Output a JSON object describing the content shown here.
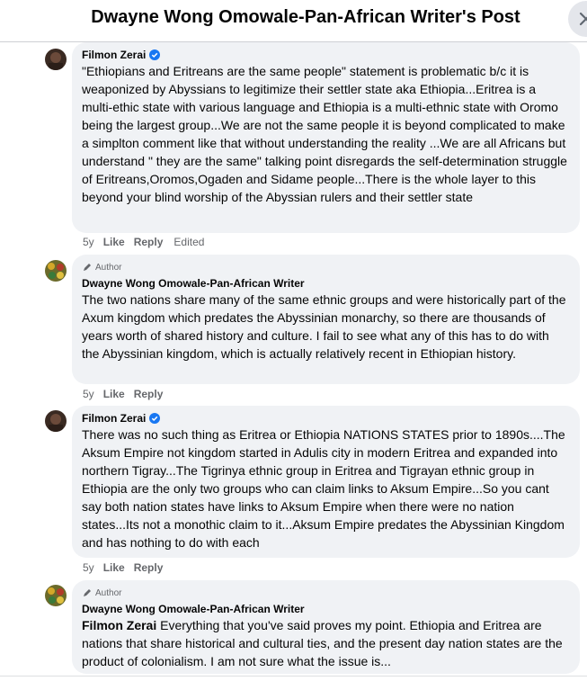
{
  "header": {
    "title": "Dwayne Wong Omowale-Pan-African Writer's Post"
  },
  "comments": [
    {
      "author": "Filmon Zerai",
      "verified": true,
      "text": "\"Ethiopians and Eritreans are the same people\" statement is problematic b/c it is weaponized by Abyssians to legitimize their settler state aka Ethiopia...Eritrea is a multi-ethic state with various language and Ethiopia is a multi-ethnic state with Oromo being the largest group...We are not the same people it is beyond complicated to make a simplton comment like that without understanding the reality ...We are all Africans but understand \" they are the same\" talking point disregards the self-determination struggle of Eritreans,Oromos,Ogaden and Sidame people...There is the whole layer to this beyond your blind worship of the Abyssian rulers and their settler state",
      "age": "5y",
      "like": "Like",
      "reply": "Reply",
      "edited": "Edited"
    },
    {
      "badge": "Author",
      "author": "Dwayne Wong Omowale-Pan-African Writer",
      "text": "The two nations share many of the same ethnic groups and were historically part of the Axum kingdom which predates the Abyssinian monarchy, so there are thousands of years worth of shared history and culture. I fail to see what any of this has to do with the Abyssinian kingdom, which is actually relatively recent in Ethiopian history.",
      "age": "5y",
      "like": "Like",
      "reply": "Reply"
    },
    {
      "author": "Filmon Zerai",
      "verified": true,
      "text": "There was no such thing as Eritrea or Ethiopia NATIONS STATES prior to 1890s....The Aksum Empire not kingdom started in Adulis city in modern Eritrea and expanded into northern Tigray...The Tigrinya ethnic group in Eritrea and Tigrayan ethnic group in Ethiopia are the only two groups who can claim links to Aksum Empire...So you cant say both nation states have links to Aksum Empire when there were no nation states...Its not a monothic claim to it...Aksum Empire predates the Abyssinian Kingdom and has nothing to do with each",
      "age": "5y",
      "like": "Like",
      "reply": "Reply"
    },
    {
      "badge": "Author",
      "author": "Dwayne Wong Omowale-Pan-African Writer",
      "mention": "Filmon Zerai",
      "text": " Everything that you've said proves my point. Ethiopia and Eritrea are nations that share historical and cultural ties, and the present day nation states are the product of colonialism. I am not sure what the issue is..."
    }
  ],
  "colors": {
    "bubble": "#f0f2f5",
    "verified": "#1877f2",
    "meta": "#65676b"
  }
}
